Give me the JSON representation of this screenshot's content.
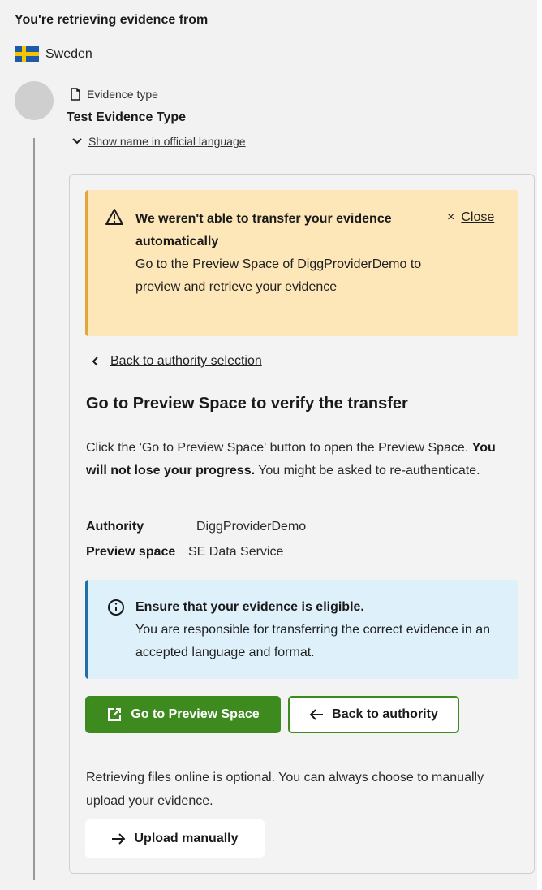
{
  "header": {
    "title": "You're retrieving evidence from",
    "country": "Sweden",
    "country_flag_icon": "sweden-flag-icon"
  },
  "evidence": {
    "type_label": "Evidence type",
    "name": "Test Evidence Type",
    "show_official_language_label": "Show name in official language"
  },
  "warning_alert": {
    "title": "We weren't able to transfer your evidence automatically",
    "body": "Go to the Preview Space of DiggProviderDemo to preview and retrieve your evidence",
    "close_label": "Close",
    "close_glyph": "×",
    "background_color": "#fde6b8"
  },
  "back_link": {
    "label": "Back to authority selection"
  },
  "section": {
    "title": "Go to Preview Space to verify the transfer",
    "desc_part1": "Click the 'Go to Preview Space' button to open the Preview Space. ",
    "desc_bold": "You will not lose your progress.",
    "desc_part2": " You might be asked to re-authenticate."
  },
  "details": {
    "authority_label": "Authority",
    "authority_value": "DiggProviderDemo",
    "preview_space_label": "Preview space",
    "preview_space_value": "SE Data Service"
  },
  "info_alert": {
    "title": "Ensure that your evidence is eligible.",
    "body": "You are responsible for transferring the correct evidence in an accepted language and format.",
    "background_color": "#def0fa"
  },
  "buttons": {
    "go_preview_label": "Go to Preview Space",
    "back_authority_label": "Back to authority",
    "upload_label": "Upload manually",
    "primary_color": "#3d8b1f"
  },
  "footer": {
    "optional_text": "Retrieving files online is optional. You can always choose to manually upload your evidence."
  }
}
